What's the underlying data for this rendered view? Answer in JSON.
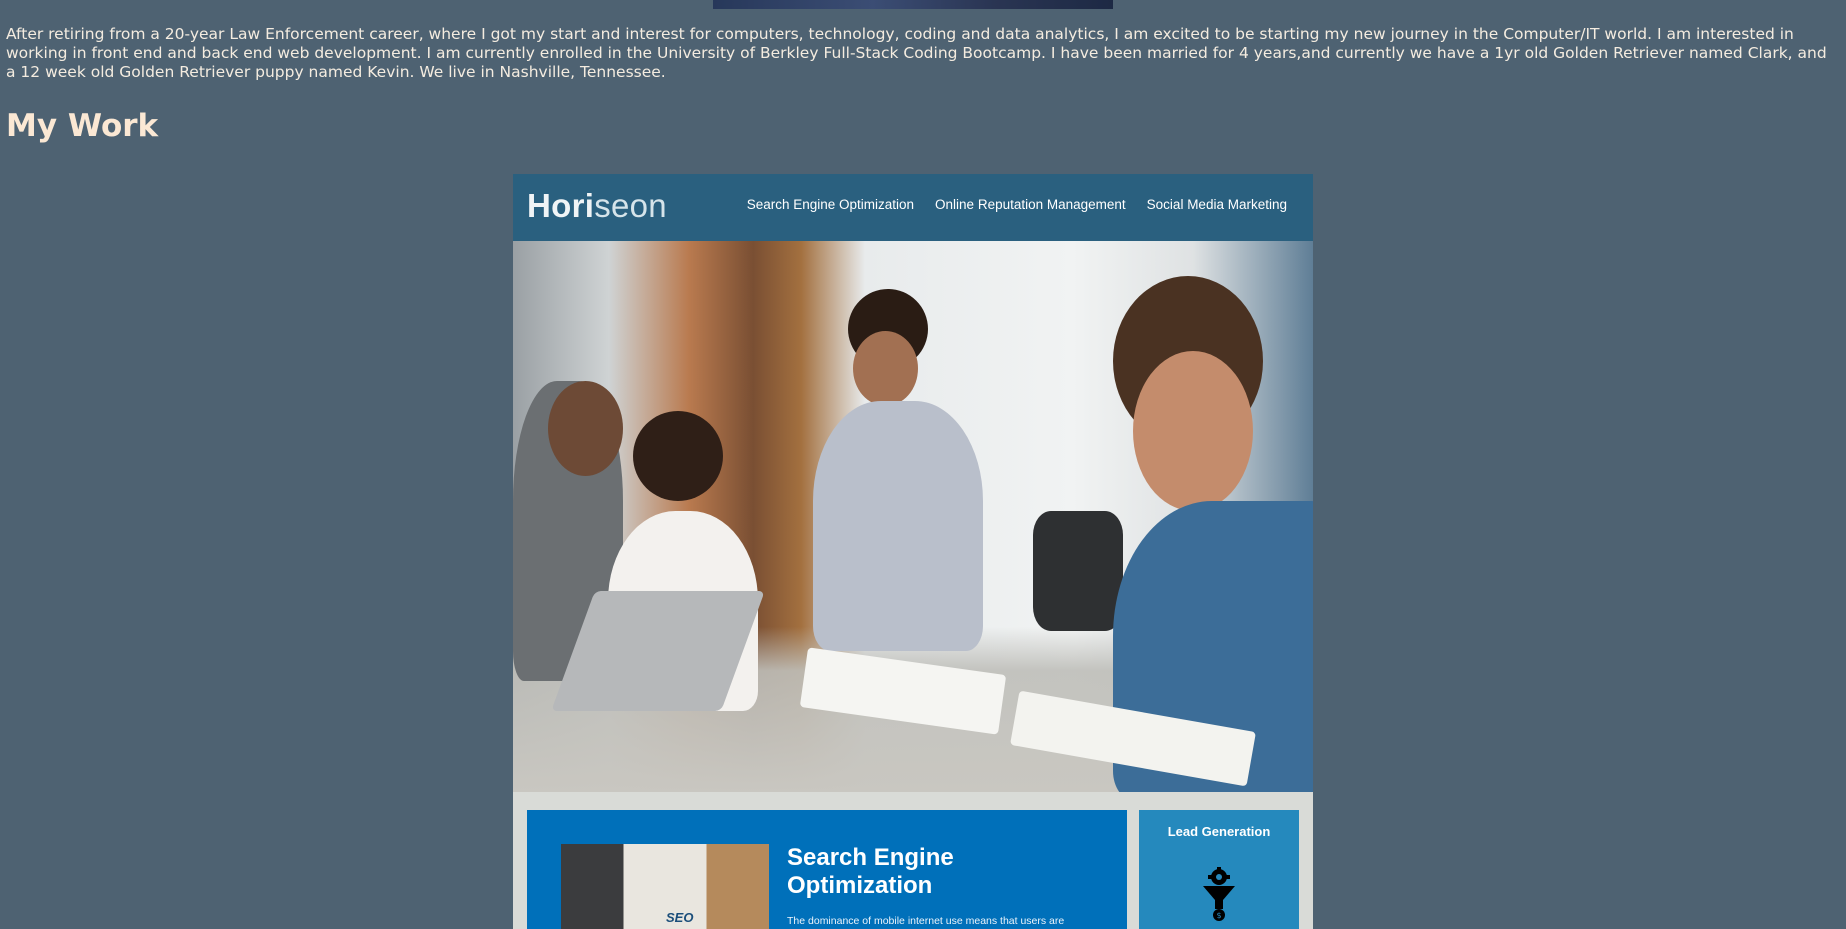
{
  "about": {
    "bio": "After retiring from a 20-year Law Enforcement career, where I got my start and interest for computers, technology, coding and data analytics, I am excited to be starting my new journey in the Computer/IT world. I am interested in working in front end and back end web development. I am currently enrolled in the University of Berkley Full-Stack Coding Bootcamp. I have been married for 4 years,and currently we have a 1yr old Golden Retriever named Clark, and a 12 week old Golden Retriever puppy named Kevin. We live in Nashville, Tennessee."
  },
  "work": {
    "title": "My Work",
    "project": {
      "logo_main": "Hori",
      "logo_accent": "seon",
      "nav": [
        "Search Engine Optimization",
        "Online Reputation Management",
        "Social Media Marketing"
      ],
      "content_title": "Search Engine Optimization",
      "content_image_label": "SEO",
      "content_body": "The dominance of mobile internet use means that users are",
      "aside_title": "Lead Generation"
    }
  },
  "colors": {
    "page_bg": "#4e6272",
    "heading": "#fbe8d4",
    "preview_header": "#2a607f",
    "preview_content": "#0070ba",
    "preview_aside": "#2589bd"
  },
  "icons": {
    "aside": "funnel-gear-icon"
  }
}
